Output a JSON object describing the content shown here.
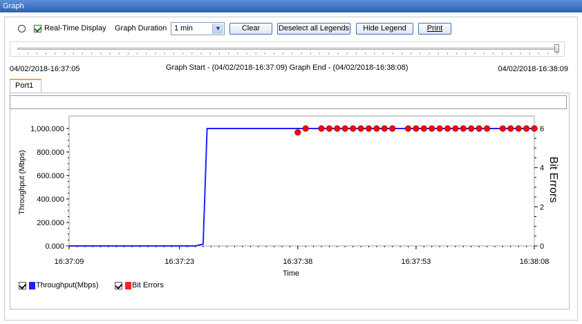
{
  "window": {
    "title": "Graph"
  },
  "controls": {
    "realtime_label": "Real-Time Display",
    "duration_label": "Graph Duration",
    "duration_value": "1 min",
    "clear_label": "Clear",
    "deselect_label": "Deselect all Legends",
    "hide_legend_label": "Hide Legend",
    "print_label": "Print"
  },
  "range": {
    "left_time": "04/02/2018-16:37:05",
    "center_text": "Graph Start - (04/02/2018-16:37:09) Graph End - (04/02/2018-16:38:08)",
    "right_time": "04/02/2018-16:38:09",
    "slider_position": 1.0
  },
  "tabs": [
    {
      "label": "Port1"
    }
  ],
  "colors": {
    "throughput": "#1f1fff",
    "bit_errors": "#ff0000",
    "accent": "#3f74c4"
  },
  "legend": [
    {
      "label": "Throughput(Mbps)",
      "checked": true,
      "color": "#1f1fff"
    },
    {
      "label": "Bit Errors",
      "checked": true,
      "color": "#ff2020"
    }
  ],
  "chart_data": {
    "type": "line",
    "title": "",
    "xlabel": "Time",
    "ylabel": "Throughput (Mbps)",
    "y2label": "Bit Errors",
    "x_ticks": [
      "16:37:09",
      "16:37:23",
      "16:37:38",
      "16:37:53",
      "16:38:08"
    ],
    "y_ticks": [
      "0.000",
      "200.000",
      "400.000",
      "600.000",
      "800.000",
      "1,000.000"
    ],
    "y2_ticks": [
      "0",
      "2",
      "4",
      "6"
    ],
    "ylim": [
      0,
      1000
    ],
    "y2lim": [
      0,
      6
    ],
    "series": [
      {
        "name": "Throughput(Mbps)",
        "axis": "left",
        "x": [
          "16:37:09",
          "16:37:25",
          "16:37:26",
          "16:37:26.5",
          "16:38:08"
        ],
        "values": [
          0,
          0,
          15,
          1000,
          1000
        ]
      },
      {
        "name": "Bit Errors",
        "axis": "right",
        "x": [
          "16:37:38",
          "16:37:39",
          "16:37:41",
          "16:37:42",
          "16:37:43",
          "16:37:44",
          "16:37:45",
          "16:37:46",
          "16:37:47",
          "16:37:48",
          "16:37:49",
          "16:37:50",
          "16:37:52",
          "16:37:53",
          "16:37:54",
          "16:37:55",
          "16:37:56",
          "16:37:57",
          "16:37:58",
          "16:37:59",
          "16:38:00",
          "16:38:01",
          "16:38:02",
          "16:38:04",
          "16:38:05",
          "16:38:06",
          "16:38:07",
          "16:38:08"
        ],
        "values": [
          5.8,
          6,
          6,
          6,
          6,
          6,
          6,
          6,
          6,
          6,
          6,
          6,
          6,
          6,
          6,
          6,
          6,
          6,
          6,
          6,
          6,
          6,
          6,
          6,
          6,
          6,
          6,
          6
        ]
      }
    ]
  }
}
